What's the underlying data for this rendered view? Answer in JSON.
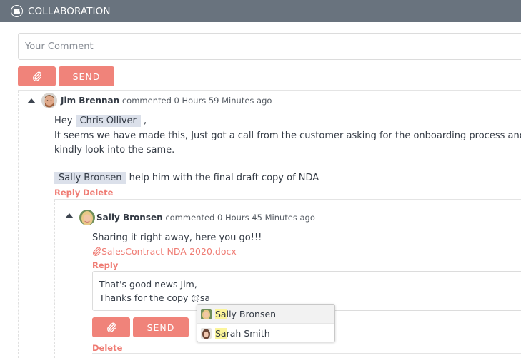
{
  "header": {
    "title": "COLLABORATION",
    "icon": "group-icon"
  },
  "new_comment": {
    "placeholder": "Your Comment",
    "value": "",
    "attach_icon": "paperclip-icon",
    "send_label": "SEND"
  },
  "colors": {
    "header_bg": "#69737e",
    "accent": "#f0837a",
    "link": "#ef7c74",
    "mention_bg": "#dbe0ea",
    "match_highlight": "#fbf59b"
  },
  "comments": [
    {
      "author": "Jim Brennan",
      "meta": "commented 0 Hours 59 Minutes ago",
      "collapse_icon": "caret-up-icon",
      "lines": {
        "greeting": "Hey",
        "mention1": "Chris Olliver",
        "greeting_suffix": ",",
        "line2": "It seems we have made this, Just got a call from the customer asking for the onboarding process and NDA",
        "line3": "kindly look into the same.",
        "mention2": "Sally Bronsen",
        "line4": "help him with the final draft copy of NDA"
      },
      "actions": {
        "reply": "Reply",
        "delete": "Delete"
      },
      "replies": [
        {
          "author": "Sally Bronsen",
          "meta": "commented 0 Hours 45 Minutes ago",
          "collapse_icon": "caret-up-icon",
          "text": "Sharing it right away, here you go!!!",
          "attachment": "SalesContract-NDA-2020.docx",
          "actions": {
            "reply": "Reply",
            "delete": "Delete"
          },
          "reply_form": {
            "line1": "That's good news Jim,",
            "line2_prefix": "Thanks for the copy @",
            "line2_query": "sa",
            "send_label": "SEND",
            "mention_suggestions": [
              {
                "match": "Sa",
                "rest": "lly Bronsen",
                "name": "Sally Bronsen",
                "active": true
              },
              {
                "match": "Sa",
                "rest": "rah Smith",
                "name": "Sarah Smith",
                "active": false
              }
            ]
          }
        }
      ]
    }
  ]
}
